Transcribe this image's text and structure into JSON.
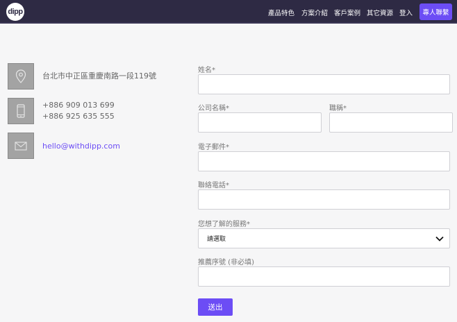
{
  "navbar": {
    "logo_text": "dipp",
    "links": [
      "產品特色",
      "方案介紹",
      "客戶案例",
      "其它資源",
      "登入"
    ],
    "cta_label": "專人聯繫"
  },
  "contact": {
    "address": "台北市中正區重慶南路一段119號",
    "phone_1": "+886 909 013 699",
    "phone_2": "+886 925 635 555",
    "email": "hello@withdipp.com",
    "icons": [
      "location-pin-icon",
      "mobile-phone-icon",
      "envelope-icon"
    ]
  },
  "form": {
    "name_label": "姓名*",
    "company_label": "公司名稱*",
    "title_label": "職稱*",
    "email_label": "電子郵件*",
    "phone_label": "聯絡電話*",
    "service_label": "您想了解的服務*",
    "service_selected": "請選取",
    "referral_label": "推薦序號 (非必填)",
    "submit_label": "送出"
  },
  "colors": {
    "navbar_bg": "#2e2a44",
    "accent": "#6c4df5",
    "page_bg": "#f6f6f7"
  }
}
